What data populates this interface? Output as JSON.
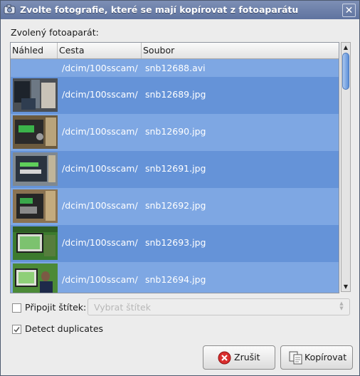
{
  "window": {
    "title": "Zvolte fotografie, které se mají kopírovat z fotoaparátu",
    "close_glyph": "✕"
  },
  "camera_label": "Zvolený fotoaparát:",
  "list": {
    "headers": {
      "preview": "Náhled",
      "path": "Cesta",
      "file": "Soubor"
    },
    "rows": [
      {
        "path": "/dcim/100sscam/",
        "file": "snb12688.avi"
      },
      {
        "path": "/dcim/100sscam/",
        "file": "snb12689.jpg"
      },
      {
        "path": "/dcim/100sscam/",
        "file": "snb12690.jpg"
      },
      {
        "path": "/dcim/100sscam/",
        "file": "snb12691.jpg"
      },
      {
        "path": "/dcim/100sscam/",
        "file": "snb12692.jpg"
      },
      {
        "path": "/dcim/100sscam/",
        "file": "snb12693.jpg"
      },
      {
        "path": "/dcim/100sscam/",
        "file": "snb12694.jpg"
      }
    ]
  },
  "tag": {
    "label": "Připojit štítek:",
    "checked": false,
    "placeholder": "Vybrat štítek"
  },
  "duplicates": {
    "label": "Detect duplicates",
    "checked": true
  },
  "buttons": {
    "cancel": "Zrušit",
    "copy": "Kopírovat"
  },
  "colors": {
    "selection_light": "#7ea7e3",
    "selection_dark": "#6593d8",
    "titlebar": "#6b7ea8"
  }
}
